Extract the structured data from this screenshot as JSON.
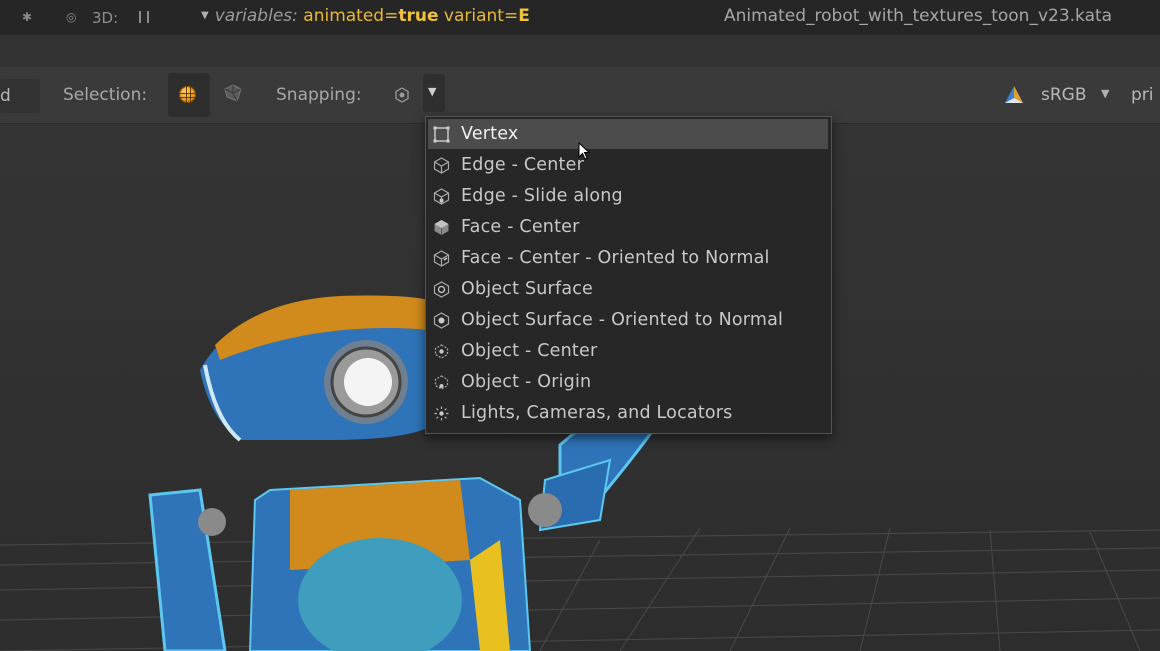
{
  "topbar": {
    "mode_label": "3D:",
    "variables_label": "variables:",
    "var1_key": "animated",
    "var1_eq": "=",
    "var1_val": "true",
    "var2_key": "variant",
    "var2_eq": "=",
    "var2_val": "E",
    "filename": "Animated_robot_with_textures_toon_v23.kata"
  },
  "toolbar": {
    "left_clip": "d",
    "selection_label": "Selection:",
    "snapping_label": "Snapping:",
    "color_space": "sRGB",
    "right_clip": "pri"
  },
  "snap_menu": {
    "items": [
      {
        "label": "Vertex",
        "icon": "vertex-snap-icon",
        "highlighted": true
      },
      {
        "label": "Edge - Center",
        "icon": "edge-center-icon"
      },
      {
        "label": "Edge - Slide along",
        "icon": "edge-slide-icon"
      },
      {
        "label": "Face - Center",
        "icon": "face-center-icon"
      },
      {
        "label": "Face - Center - Oriented to Normal",
        "icon": "face-normal-icon"
      },
      {
        "label": "Object Surface",
        "icon": "object-surface-icon"
      },
      {
        "label": "Object Surface - Oriented to Normal",
        "icon": "object-surface-normal-icon"
      },
      {
        "label": "Object - Center",
        "icon": "object-center-icon"
      },
      {
        "label": "Object - Origin",
        "icon": "object-origin-icon"
      },
      {
        "label": "Lights, Cameras, and Locators",
        "icon": "lights-cameras-icon"
      }
    ]
  },
  "colors": {
    "accent": "#e8b83a",
    "menu_bg": "#272727",
    "menu_highlight": "#4c4c4c",
    "robot_blue": "#2f73b8",
    "robot_orange": "#d18a1c"
  }
}
